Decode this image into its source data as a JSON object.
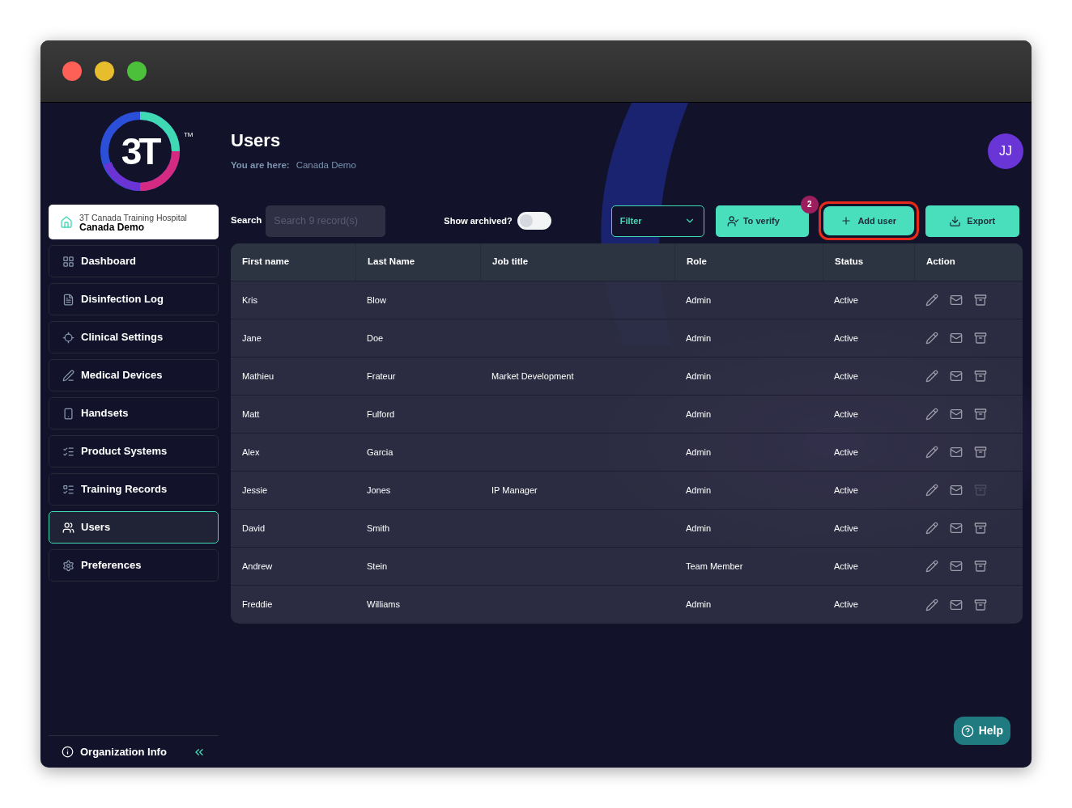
{
  "logo": {
    "mark": "3T",
    "trademark": "TM"
  },
  "organization": {
    "name": "3T Canada Training Hospital",
    "site": "Canada Demo"
  },
  "sidebar": {
    "items": [
      {
        "label": "Dashboard",
        "selected": false
      },
      {
        "label": "Disinfection Log",
        "selected": false
      },
      {
        "label": "Clinical Settings",
        "selected": false
      },
      {
        "label": "Medical Devices",
        "selected": false
      },
      {
        "label": "Handsets",
        "selected": false
      },
      {
        "label": "Product Systems",
        "selected": false
      },
      {
        "label": "Training Records",
        "selected": false
      },
      {
        "label": "Users",
        "selected": true
      },
      {
        "label": "Preferences",
        "selected": false
      }
    ],
    "footer": "Organization Info"
  },
  "header": {
    "title": "Users",
    "breadcrumb_label": "You are here:",
    "breadcrumb": "Canada Demo",
    "avatar": "JJ"
  },
  "toolbar": {
    "search_label": "Search",
    "search_placeholder": "Search 9 record(s)",
    "show_archived_label": "Show archived?",
    "show_archived": false,
    "filter": "Filter",
    "to_verify": "To verify",
    "to_verify_count": "2",
    "add_user": "Add user",
    "add_user_highlighted": true,
    "export": "Export"
  },
  "table": {
    "columns": [
      "First name",
      "Last Name",
      "Job title",
      "Role",
      "Status",
      "Action"
    ],
    "rows": [
      {
        "first": "Kris",
        "last": "Blow",
        "job": "",
        "role": "Admin",
        "status": "Active",
        "archive_disabled": false
      },
      {
        "first": "Jane",
        "last": "Doe",
        "job": "",
        "role": "Admin",
        "status": "Active",
        "archive_disabled": false
      },
      {
        "first": "Mathieu",
        "last": "Frateur",
        "job": "Market Development",
        "role": "Admin",
        "status": "Active",
        "archive_disabled": false
      },
      {
        "first": "Matt",
        "last": "Fulford",
        "job": "",
        "role": "Admin",
        "status": "Active",
        "archive_disabled": false
      },
      {
        "first": "Alex",
        "last": "Garcia",
        "job": "",
        "role": "Admin",
        "status": "Active",
        "archive_disabled": false
      },
      {
        "first": "Jessie",
        "last": "Jones",
        "job": "IP Manager",
        "role": "Admin",
        "status": "Active",
        "archive_disabled": true
      },
      {
        "first": "David",
        "last": "Smith",
        "job": "",
        "role": "Admin",
        "status": "Active",
        "archive_disabled": false
      },
      {
        "first": "Andrew",
        "last": "Stein",
        "job": "",
        "role": "Team Member",
        "status": "Active",
        "archive_disabled": false
      },
      {
        "first": "Freddie",
        "last": "Williams",
        "job": "",
        "role": "Admin",
        "status": "Active",
        "archive_disabled": false
      }
    ]
  },
  "help": "Help"
}
